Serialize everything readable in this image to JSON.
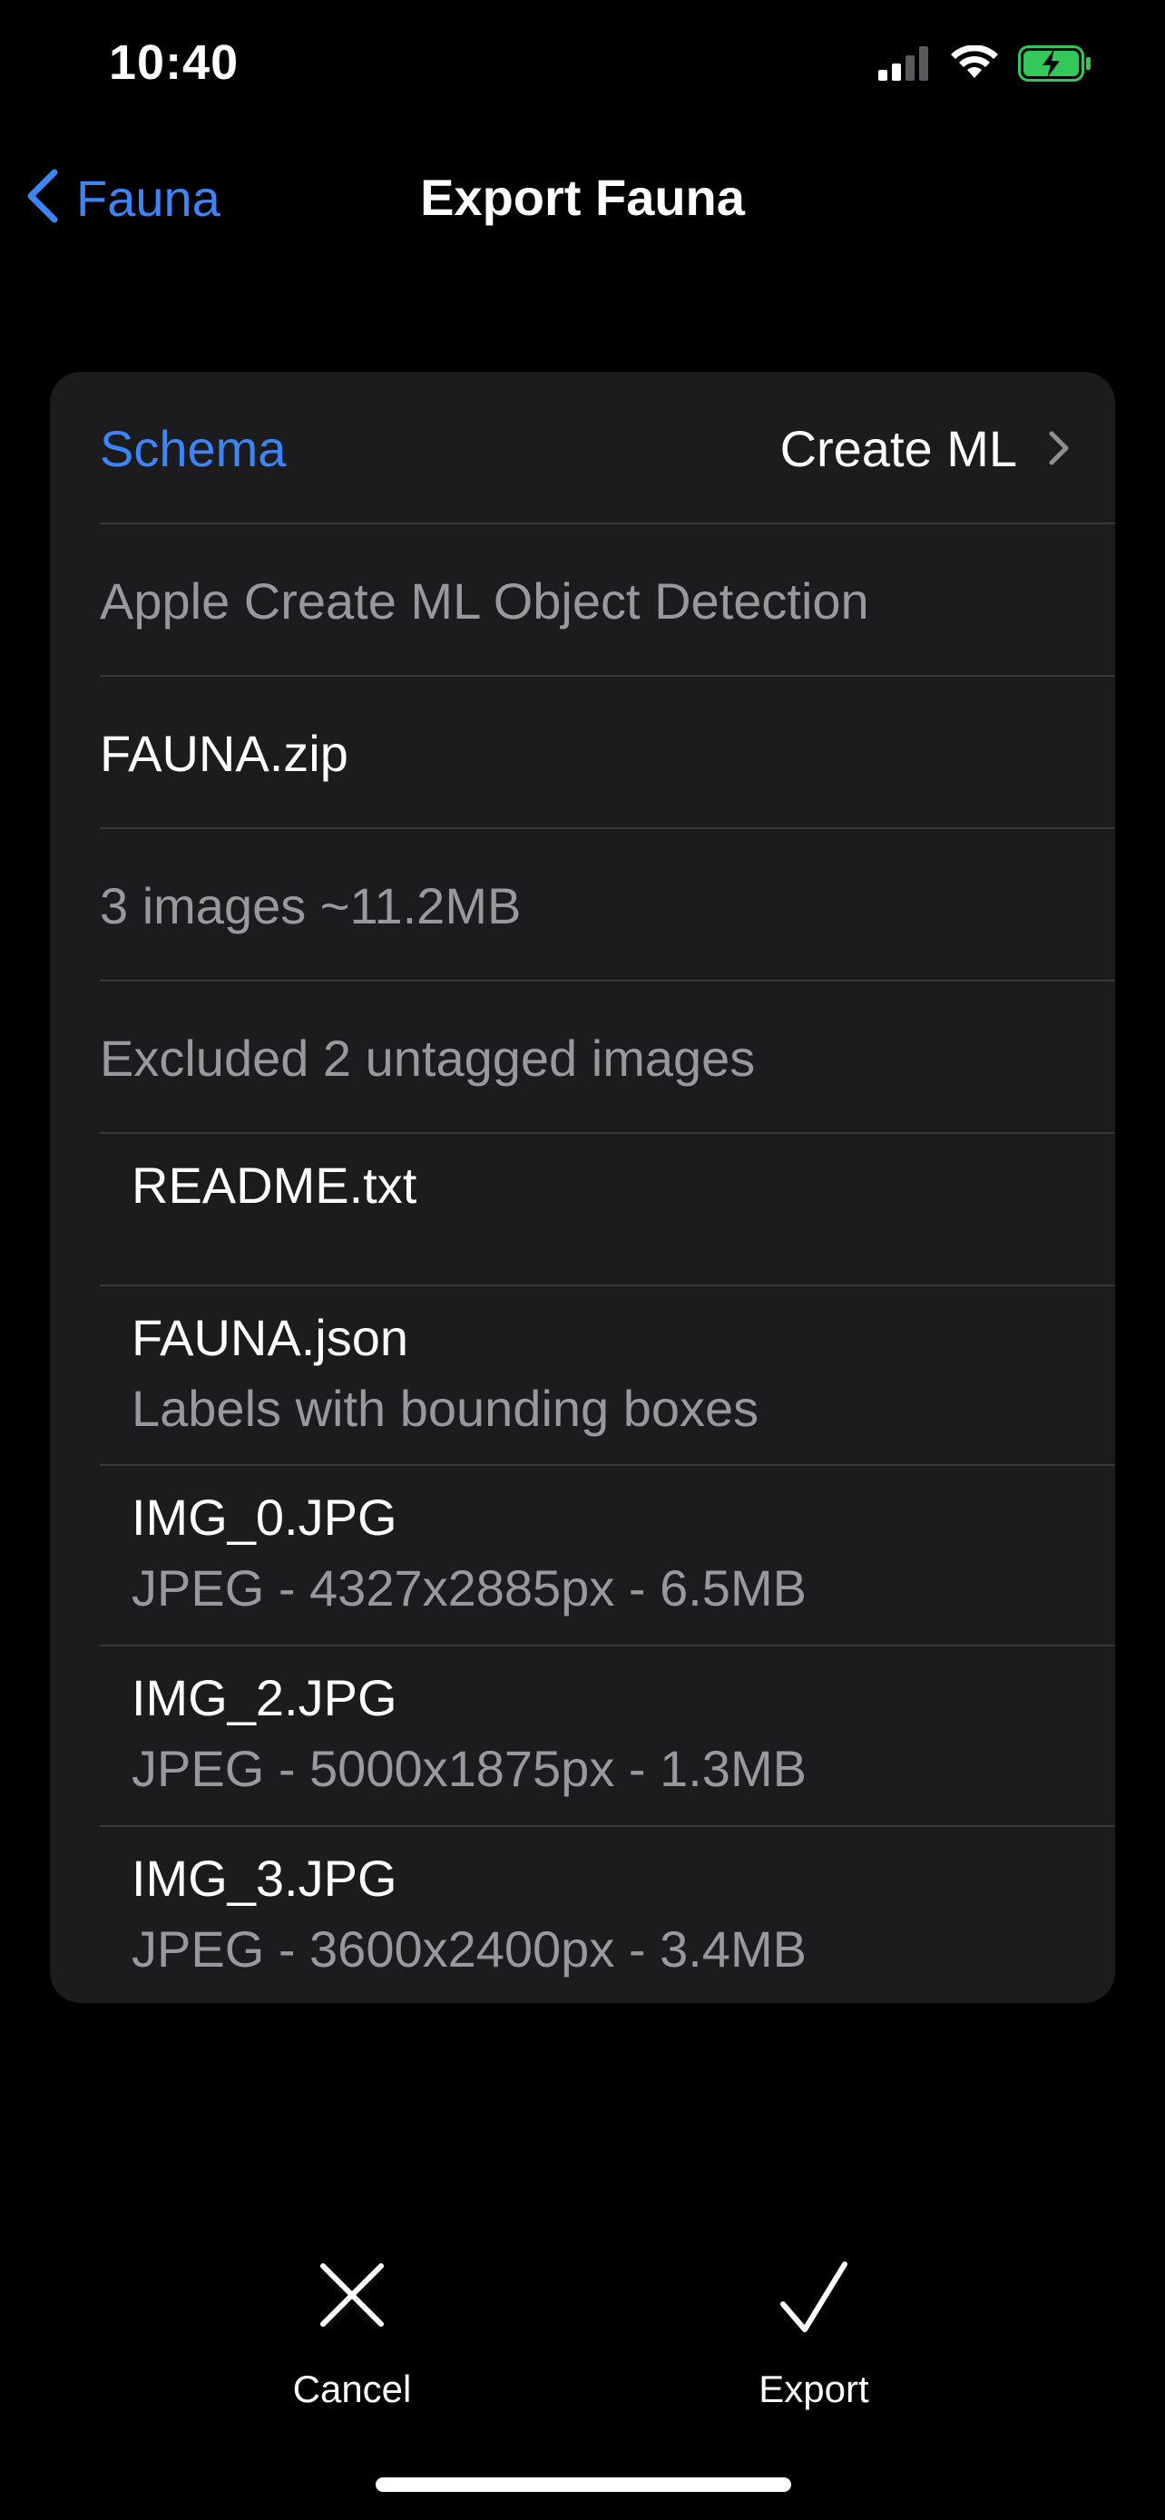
{
  "status_bar": {
    "time": "10:40",
    "signal_icon": "cellular-signal-icon",
    "wifi_icon": "wifi-icon",
    "battery_icon": "battery-charging-icon",
    "battery_color": "#34c759"
  },
  "nav": {
    "back_label": "Fauna",
    "title": "Export Fauna"
  },
  "colors": {
    "accent": "#3d84f7",
    "card_background": "#1c1c1e",
    "secondary_text": "#98989f"
  },
  "card": {
    "schema_label": "Schema",
    "schema_value": "Create ML",
    "schema_description": "Apple Create ML Object Detection",
    "archive_name": "FAUNA.zip",
    "summary": "3 images ~11.2MB",
    "excluded": "Excluded 2 untagged images",
    "files": [
      {
        "name": "README.txt",
        "detail": ""
      },
      {
        "name": "FAUNA.json",
        "detail": "Labels with bounding boxes"
      },
      {
        "name": "IMG_0.JPG",
        "detail": "JPEG - 4327x2885px - 6.5MB"
      },
      {
        "name": "IMG_2.JPG",
        "detail": "JPEG - 5000x1875px - 1.3MB"
      },
      {
        "name": "IMG_3.JPG",
        "detail": "JPEG - 3600x2400px - 3.4MB"
      }
    ]
  },
  "toolbar": {
    "cancel_label": "Cancel",
    "cancel_icon": "close-icon",
    "export_label": "Export",
    "export_icon": "checkmark-icon"
  }
}
